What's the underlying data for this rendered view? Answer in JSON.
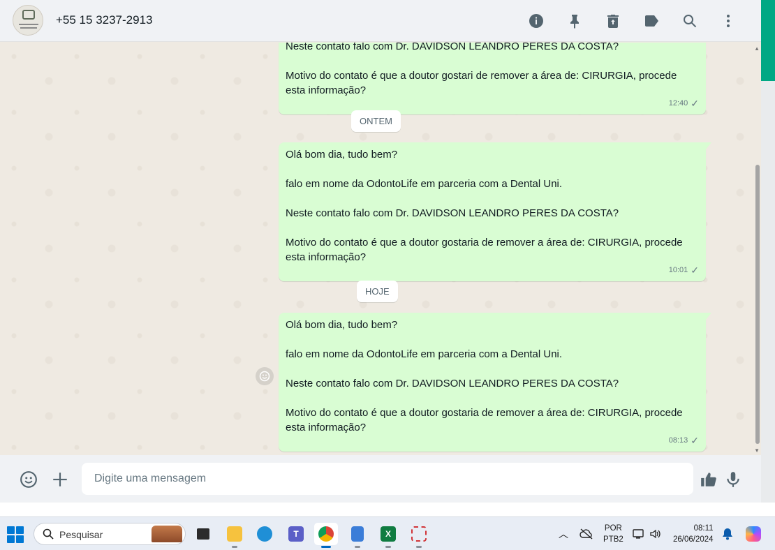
{
  "header": {
    "contact_name": "+55 15 3237-2913",
    "icons": [
      "info-icon",
      "pin-icon",
      "delete-icon",
      "label-icon",
      "search-icon",
      "menu-icon"
    ]
  },
  "messages": [
    {
      "lines": [
        "Neste contato falo com Dr. DAVIDSON LEANDRO PERES DA COSTA?",
        "",
        "Motivo do contato é que a doutor gostari de remover a área de: CIRURGIA, procede esta informação?"
      ],
      "time": "12:40"
    },
    {
      "date_label": "ONTEM",
      "lines": [
        "Olá bom dia, tudo bem?",
        "",
        "falo em nome da OdontoLife em parceria com a Dental Uni.",
        "",
        "Neste contato falo com Dr. DAVIDSON LEANDRO PERES DA COSTA?",
        "",
        "Motivo do contato é que a doutor gostaria de remover a área de: CIRURGIA, procede esta informação?"
      ],
      "time": "10:01"
    },
    {
      "date_label": "HOJE",
      "lines": [
        "Olá bom dia, tudo bem?",
        "",
        "falo em nome da OdontoLife em parceria com a Dental Uni.",
        "",
        "Neste contato falo com Dr. DAVIDSON LEANDRO PERES DA COSTA?",
        "",
        "Motivo do contato é que a doutor gostaria de remover a área de: CIRURGIA, procede esta informação?"
      ],
      "time": "08:13"
    }
  ],
  "composer": {
    "placeholder": "Digite uma mensagem"
  },
  "taskbar": {
    "search_label": "Pesquisar",
    "apps": [
      "task-view",
      "file-explorer",
      "edge",
      "teams",
      "chrome",
      "notepad",
      "excel",
      "snipping-tool"
    ],
    "language_line1": "POR",
    "language_line2": "PTB2",
    "time": "08:11",
    "date": "26/06/2024"
  },
  "colors": {
    "bubble": "#d9fdd3",
    "chat_bg": "#efeae2",
    "header_bg": "#f0f2f5",
    "accent": "#00a884"
  }
}
